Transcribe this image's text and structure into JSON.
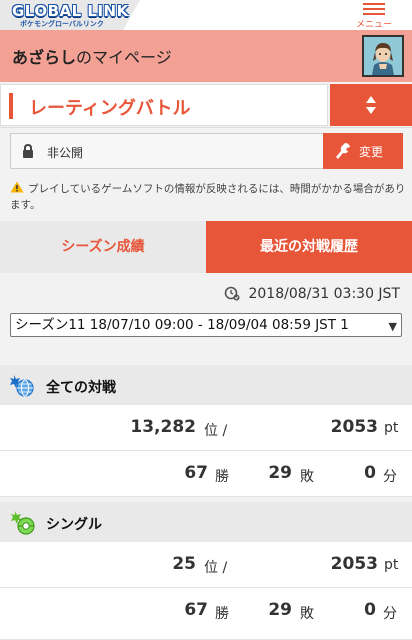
{
  "header": {
    "logo_main": "GLOBAL LINK",
    "logo_sub": "ポケモングローバルリンク",
    "menu_label": "メニュー"
  },
  "mypage": {
    "user_name": "あざらし",
    "suffix": "のマイページ"
  },
  "rating": {
    "title": "レーティングバトル"
  },
  "visibility": {
    "value": "非公開",
    "change_label": "変更"
  },
  "notice": "プレイしているゲームソフトの情報が反映されるには、時間がかかる場合があります。",
  "tabs": [
    {
      "label": "シーズン成績",
      "active": true
    },
    {
      "label": "最近の対戦履歴",
      "active": false
    }
  ],
  "updated_at": "2018/08/31 03:30 JST",
  "season_select": "シーズン11 18/07/10 09:00 - 18/09/04 08:59 JST 1",
  "sections": [
    {
      "title": "全ての対戦",
      "rank": "13,282",
      "rank_unit": "位 /",
      "rating": "2053",
      "rating_unit": "pt",
      "wins": "67",
      "wins_unit": "勝",
      "losses": "29",
      "losses_unit": "敗",
      "draws": "0",
      "draws_unit": "分"
    },
    {
      "title": "シングル",
      "rank": "25",
      "rank_unit": "位 /",
      "rating": "2053",
      "rating_unit": "pt",
      "wins": "67",
      "wins_unit": "勝",
      "losses": "29",
      "losses_unit": "敗",
      "draws": "0",
      "draws_unit": "分"
    }
  ],
  "colors": {
    "accent": "#e8563a",
    "mypage_bg": "#f3a195",
    "section_bg": "#e9e9e9"
  },
  "icons": {
    "menu": "hamburger-icon",
    "avatar": "trainer-avatar",
    "toggle": "up-down-arrows-icon",
    "lock": "lock-icon",
    "change": "wrench-icon",
    "warning": "warning-icon",
    "clock": "refresh-clock-icon",
    "all_battles": "globe-icon",
    "single": "single-battle-icon"
  }
}
